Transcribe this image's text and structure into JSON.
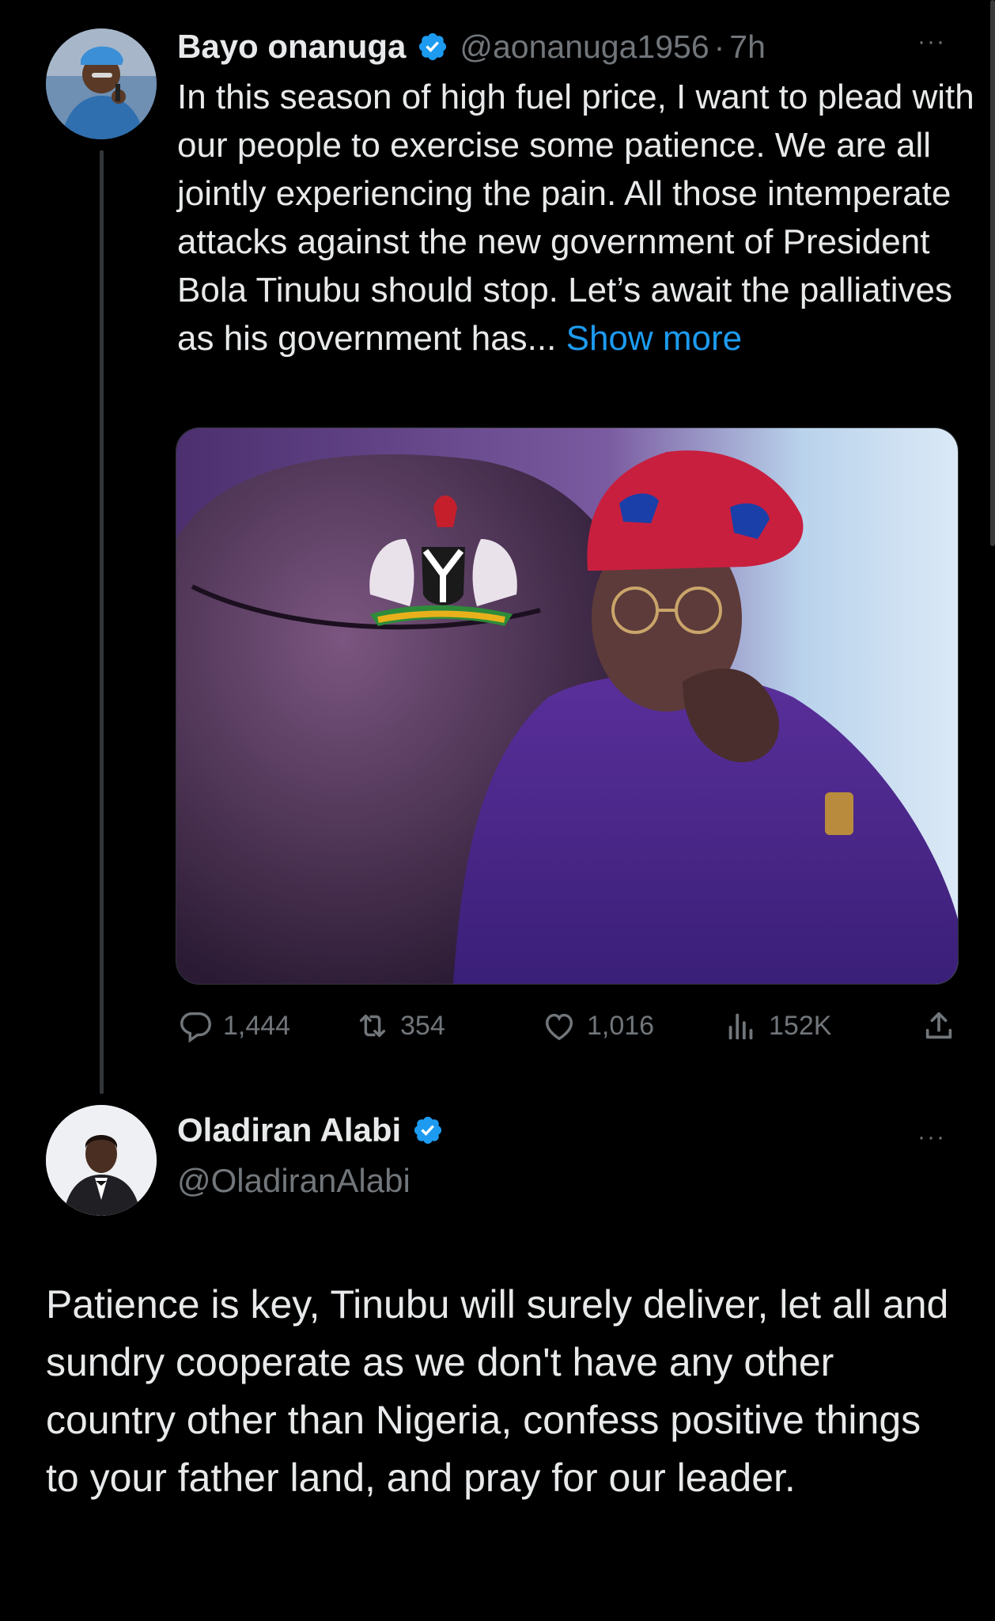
{
  "tweet1": {
    "author_name": "Bayo onanuga",
    "handle": "@aonanuga1956",
    "separator": "·",
    "time": "7h",
    "text": "In this season of high fuel price, I want to plead with our people to exercise some patience. We are all jointly experiencing the pain. All those intemperate attacks against the new government of President Bola Tinubu should stop. Let’s await the palliatives as his government has...",
    "show_more": "Show more",
    "stats": {
      "replies": "1,444",
      "retweets": "354",
      "likes": "1,016",
      "views": "152K"
    }
  },
  "tweet2": {
    "author_name": "Oladiran Alabi",
    "handle": "@OladiranAlabi",
    "text": "Patience is key, Tinubu will surely deliver, let all and sundry cooperate as we don't have any other country other than Nigeria,  confess positive  things to your father land, and pray for our leader."
  },
  "more_label": "···",
  "colors": {
    "background": "#000000",
    "text": "#e7e9ea",
    "muted": "#71767b",
    "link": "#1d9bf0",
    "verified": "#1d9bf0",
    "cap_red": "#c81f3f",
    "cap_blue": "#1a3fa8"
  },
  "icons": [
    "verified-badge-icon",
    "more-icon",
    "reply-icon",
    "retweet-icon",
    "like-icon",
    "views-icon",
    "share-icon"
  ]
}
